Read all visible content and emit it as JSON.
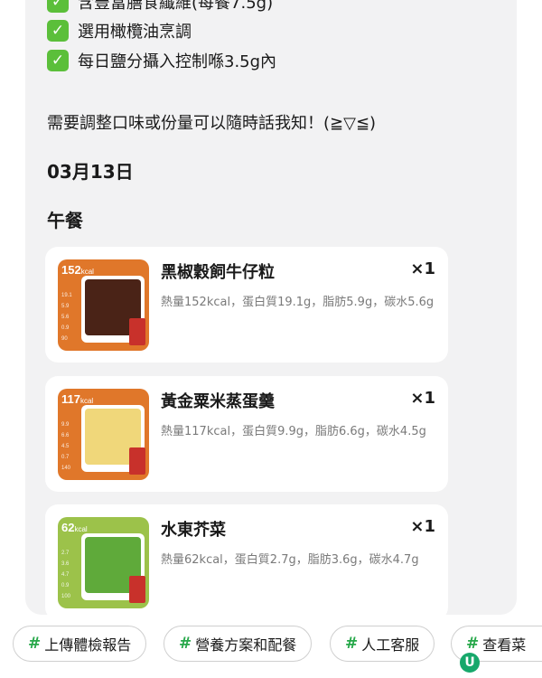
{
  "checklist": [
    {
      "text": "含豐富膳食纖維(每餐7.5g)"
    },
    {
      "text": "選用橄欖油烹調"
    },
    {
      "text": "每日鹽分攝入控制喺3.5g內"
    }
  ],
  "message": "需要調整口味或份量可以隨時話我知！(≧▽≦)",
  "date": "03月13日",
  "meal_title": "午餐",
  "items": [
    {
      "name": "黑椒穀飼牛仔粒",
      "qty": "×1",
      "nutrition": "熱量152kcal，蛋白質19.1g，脂肪5.9g，碳水5.6g",
      "thumb_kcal": "152",
      "thumb_unit": "kcal",
      "thumb_nums": [
        "19.1",
        "5.9",
        "5.6",
        "0.9",
        "90"
      ],
      "thumb_color": "#e0772a",
      "food_color": "#4a2317"
    },
    {
      "name": "黃金粟米蒸蛋羹",
      "qty": "×1",
      "nutrition": "熱量117kcal，蛋白質9.9g，脂肪6.6g，碳水4.5g",
      "thumb_kcal": "117",
      "thumb_unit": "kcal",
      "thumb_nums": [
        "9.9",
        "6.6",
        "4.5",
        "0.7",
        "140"
      ],
      "thumb_color": "#e0772a",
      "food_color": "#f0d77a"
    },
    {
      "name": "水東芥菜",
      "qty": "×1",
      "nutrition": "熱量62kcal，蛋白質2.7g，脂肪3.6g，碳水4.7g",
      "thumb_kcal": "62",
      "thumb_unit": "kcal",
      "thumb_nums": [
        "2.7",
        "3.6",
        "4.7",
        "0.9",
        "100"
      ],
      "thumb_color": "#9cc24a",
      "food_color": "#5faa3a"
    }
  ],
  "quick_replies": [
    {
      "hash": "#",
      "label": "上傳體檢報告"
    },
    {
      "hash": "#",
      "label": "營養方案和配餐"
    },
    {
      "hash": "#",
      "label": "人工客服"
    },
    {
      "hash": "#",
      "label": "查看菜"
    }
  ],
  "logo_icon": "u-logo-icon"
}
